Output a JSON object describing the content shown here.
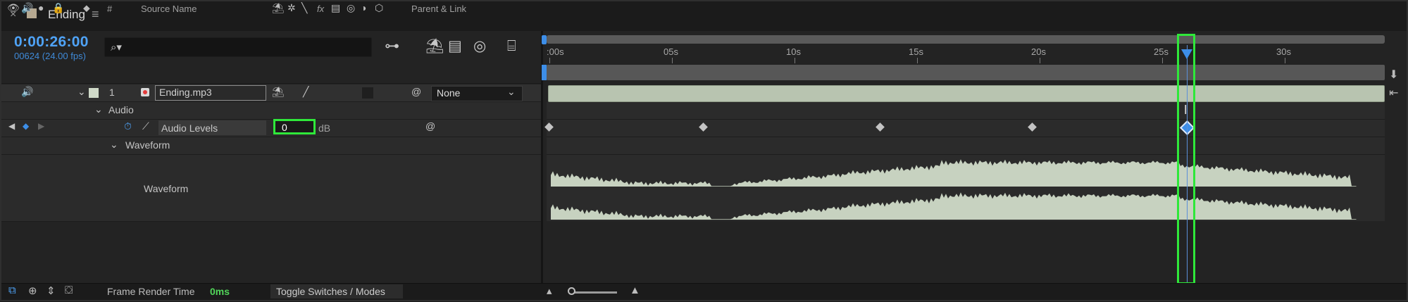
{
  "tab": {
    "close": "×",
    "title": "Ending",
    "menu": "≡"
  },
  "comp": {
    "timecode": "0:00:26:00",
    "frames": "00624 (24.00 fps)",
    "search_placeholder": "",
    "search_icon": "⌕▾"
  },
  "columns": {
    "num": "#",
    "source_name": "Source Name",
    "parent_link": "Parent & Link",
    "fx": "fx"
  },
  "layer": {
    "number": "1",
    "name": "Ending.mp3",
    "parent": "None"
  },
  "groups": {
    "audio": "Audio",
    "waveform_group": "Waveform",
    "waveform_label": "Waveform"
  },
  "property": {
    "label": "Audio Levels",
    "value": "0",
    "unit": "dB"
  },
  "ruler": {
    "labels": [
      ":00s",
      "05s",
      "10s",
      "15s",
      "20s",
      "25s",
      "30s"
    ]
  },
  "playhead": {
    "seconds": 26
  },
  "keyframes": {
    "seconds": [
      0,
      6.3,
      13.5,
      19.7,
      26
    ]
  },
  "status": {
    "frame_render_label": "Frame Render Time",
    "frame_render_value": "0ms",
    "toggle_label": "Toggle Switches / Modes"
  },
  "colors": {
    "accent": "#3d8ee8",
    "highlight": "#2fe83a",
    "layer_bar": "#b8c4b0",
    "waveform": "#c7d2c0"
  }
}
